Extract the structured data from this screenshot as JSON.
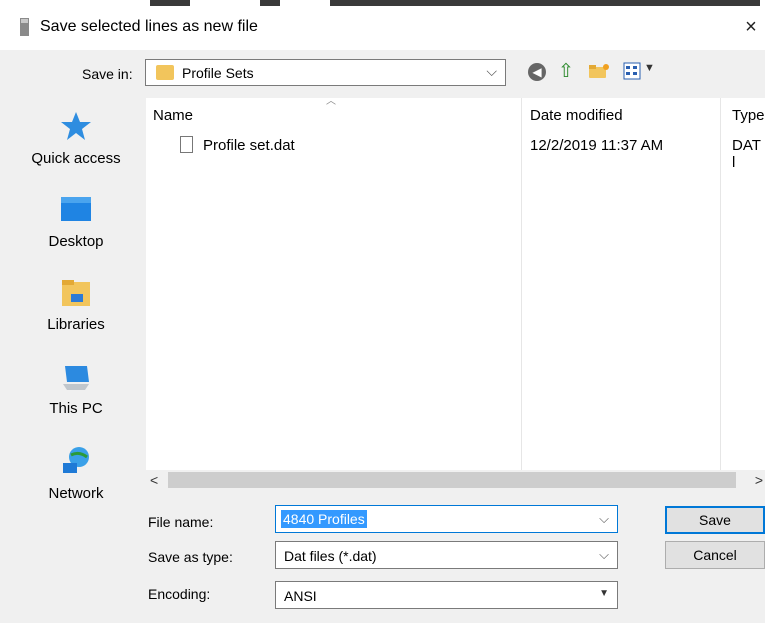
{
  "window": {
    "title": "Save selected lines as new file",
    "close_glyph": "×"
  },
  "toolbar": {
    "save_in_label": "Save in:",
    "save_in_value": "Profile Sets",
    "icons": [
      "back-icon",
      "up-folder-icon",
      "new-folder-icon",
      "view-menu-icon"
    ]
  },
  "places": [
    {
      "label": "Quick access",
      "icon": "star-icon"
    },
    {
      "label": "Desktop",
      "icon": "desktop-icon"
    },
    {
      "label": "Libraries",
      "icon": "libraries-icon"
    },
    {
      "label": "This PC",
      "icon": "computer-icon"
    },
    {
      "label": "Network",
      "icon": "network-icon"
    }
  ],
  "file_list": {
    "columns": [
      "Name",
      "Date modified",
      "Type"
    ],
    "rows": [
      {
        "name": "Profile set.dat",
        "date": "12/2/2019 11:37 AM",
        "type": "DAT l"
      }
    ]
  },
  "form": {
    "file_name_label": "File name:",
    "file_name_value": "4840 Profiles",
    "save_type_label": "Save as type:",
    "save_type_value": "Dat files (*.dat)",
    "encoding_label": "Encoding:",
    "encoding_value": "ANSI"
  },
  "buttons": {
    "save": "Save",
    "cancel": "Cancel"
  },
  "colors": {
    "accent": "#0078d7",
    "selection": "#3399ff",
    "folder": "#f2c55c",
    "dialog_bg": "#f0f0f0"
  }
}
